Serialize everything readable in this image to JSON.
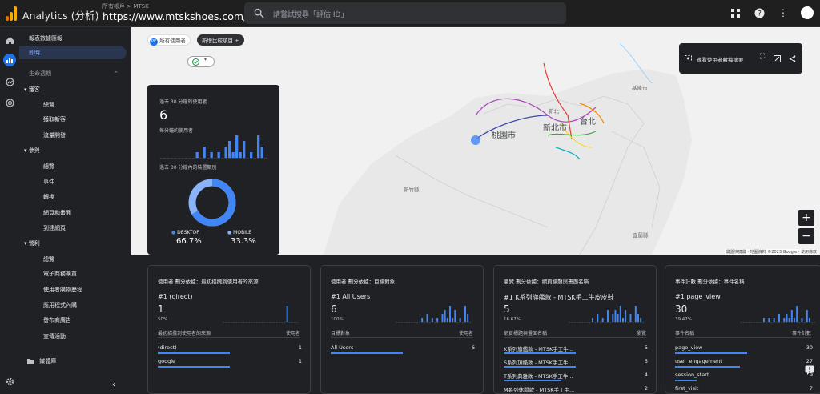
{
  "header": {
    "app_title": "Analytics (分析)",
    "account_path": "所有帳戶 > MTSK",
    "property_name": "https://www.mtskshoes.com/",
    "search_placeholder": "請嘗試搜尋「評估 ID」"
  },
  "nav": {
    "reports_snapshot": "報表數據匯報",
    "realtime": "即時",
    "lifecycle": "生命週期",
    "acquisition": "獲客",
    "acquisition_items": [
      "總覽",
      "獲取新客",
      "流量開發"
    ],
    "engagement": "參與",
    "engagement_items": [
      "總覽",
      "事件",
      "轉換",
      "網頁和畫面",
      "到達網頁"
    ],
    "monetization": "營利",
    "monetization_items": [
      "總覽",
      "電子商務購買",
      "使用者購物歷程",
      "應用程式內購",
      "發布商廣告",
      "宣傳活動"
    ],
    "library": "媒體庫"
  },
  "toolbar": {
    "all_users": "所有使用者",
    "all_users_badge": "PE",
    "add_comparison": "新增比較項目",
    "add_icon": "+"
  },
  "map": {
    "view_snapshot": "查看使用者數據摘要",
    "zoom_in": "+",
    "zoom_out": "−",
    "attribution": "鍵盤快捷鍵 · 地圖資料 ©2023 Google · 使用條款",
    "labels": {
      "taoyuan": "桃園市",
      "new_taipei": "新北市",
      "taipei": "台北",
      "keelung": "基隆市",
      "hsinchu": "新竹縣",
      "yilan": "宜蘭縣",
      "xinbei": "新北"
    }
  },
  "realtime_card": {
    "users_30min_label": "過去 30 分鐘的使用者",
    "users_30min_value": "6",
    "per_minute_label": "每分鐘的使用者",
    "device_label": "過去 30 分鐘內的裝置類別",
    "desktop_label": "DESKTOP",
    "desktop_pct": "66.7%",
    "mobile_label": "MOBILE",
    "mobile_pct": "33.3%",
    "per_minute_values": [
      0,
      0,
      0,
      0,
      0,
      0,
      0,
      0,
      0,
      0,
      1,
      0,
      2,
      0,
      1,
      0,
      1,
      0,
      2,
      3,
      1,
      4,
      1,
      3,
      0,
      1,
      0,
      4,
      2,
      0
    ],
    "desktop_fraction": 0.667,
    "colors": {
      "desktop": "#4285f4",
      "mobile": "#8ab4f8"
    }
  },
  "cards": [
    {
      "title": "使用者 劃分依據：最初招攬到使用者的來源",
      "top_label": "#1 (direct)",
      "top_value": "1",
      "top_pct": "50%",
      "col_left": "最初招攬到使用者的來源",
      "col_right": "使用者",
      "rows": [
        {
          "name": "(direct)",
          "value": "1",
          "ratio": 1
        },
        {
          "name": "google",
          "value": "1",
          "ratio": 1
        }
      ],
      "spark": [
        0,
        0,
        0,
        0,
        0,
        0,
        0,
        0,
        0,
        0,
        0,
        0,
        0,
        0,
        0,
        0,
        0,
        0,
        0,
        0,
        0,
        0,
        0,
        0,
        0,
        4,
        0,
        0,
        0,
        0
      ]
    },
    {
      "title": "使用者 劃分依據：目標對象",
      "top_label": "#1 All Users",
      "top_value": "6",
      "top_pct": "100%",
      "col_left": "目標對象",
      "col_right": "使用者",
      "rows": [
        {
          "name": "All Users",
          "value": "6",
          "ratio": 1
        }
      ],
      "spark": [
        0,
        0,
        0,
        0,
        0,
        0,
        0,
        0,
        0,
        0,
        1,
        0,
        2,
        0,
        1,
        0,
        1,
        0,
        2,
        3,
        1,
        4,
        1,
        3,
        0,
        1,
        0,
        4,
        2,
        0
      ]
    },
    {
      "title": "瀏覽 劃分依據：網頁標題與畫面名稱",
      "top_label": "#1 K系列旗艦款 - MTSK手工牛皮皮鞋",
      "top_value": "5",
      "top_pct": "16.67%",
      "col_left": "網頁標題與畫面名稱",
      "col_right": "瀏覽",
      "rows": [
        {
          "name": "K系列旗艦款 - MTSK手工牛...",
          "value": "5",
          "ratio": 1
        },
        {
          "name": "S系列頂級款 - MTSK手工牛...",
          "value": "5",
          "ratio": 1
        },
        {
          "name": "T系列典雅款 - MTSK手工牛...",
          "value": "4",
          "ratio": 0.8
        },
        {
          "name": "M系列休閒款 - MTSK手工牛...",
          "value": "2",
          "ratio": 0.4
        }
      ],
      "spark": [
        0,
        0,
        0,
        0,
        0,
        0,
        0,
        0,
        0,
        1,
        0,
        2,
        0,
        1,
        0,
        3,
        0,
        2,
        3,
        2,
        4,
        1,
        3,
        0,
        2,
        0,
        4,
        2,
        1,
        0
      ]
    },
    {
      "title": "事件計數 劃分依據：事件名稱",
      "top_label": "#1 page_view",
      "top_value": "30",
      "top_pct": "39.47%",
      "col_left": "事件名稱",
      "col_right": "事件計數",
      "rows": [
        {
          "name": "page_view",
          "value": "30",
          "ratio": 1
        },
        {
          "name": "user_engagement",
          "value": "27",
          "ratio": 0.9
        },
        {
          "name": "session_start",
          "value": "9",
          "ratio": 0.3
        },
        {
          "name": "first_visit",
          "value": "7",
          "ratio": 0.23
        }
      ],
      "spark": [
        0,
        0,
        0,
        0,
        0,
        0,
        0,
        0,
        0,
        1,
        0,
        1,
        0,
        1,
        0,
        2,
        0,
        1,
        2,
        1,
        3,
        1,
        4,
        0,
        1,
        0,
        3,
        1,
        0,
        0
      ]
    }
  ]
}
